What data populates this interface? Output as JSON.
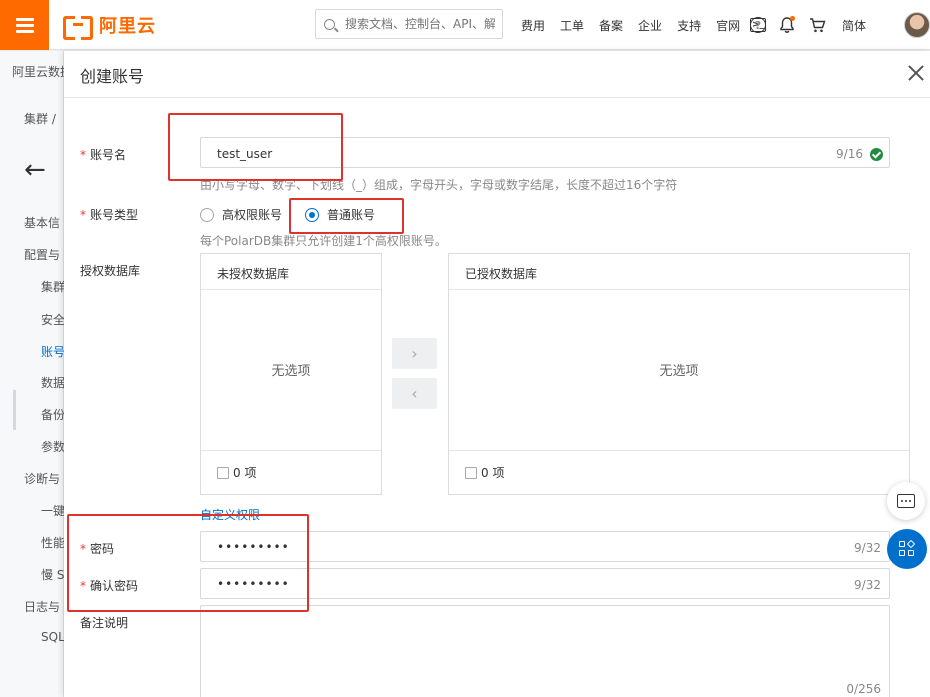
{
  "topbar": {
    "logo_text": "阿里云",
    "search_placeholder": "搜索文档、控制台、API、解",
    "links": [
      "费用",
      "工单",
      "备案",
      "企业",
      "支持",
      "官网"
    ],
    "terminal_icon_glyph": ">_",
    "help_icon_glyph": "?",
    "language": "简体",
    "accent": "#ff6a00"
  },
  "background_page": {
    "title": "阿里云数据",
    "breadcrumb": "集群",
    "breadcrumb_sep": "/",
    "items": [
      "基本信",
      "配置与",
      "集群",
      "安全",
      "账号",
      "数据",
      "备份",
      "参数",
      "诊断与",
      "一键",
      "性能",
      "慢 S",
      "日志与",
      "SQL"
    ]
  },
  "drawer": {
    "title": "创建账号",
    "account_name": {
      "label": "账号名",
      "value": "test_user",
      "counter": "9/16",
      "help": "由小写字母、数字、下划线（_）组成，字母开头，字母或数字结尾，长度不超过16个字符"
    },
    "account_type": {
      "label": "账号类型",
      "options": [
        "高权限账号",
        "普通账号"
      ],
      "selected": "普通账号",
      "help": "每个PolarDB集群只允许创建1个高权限账号。"
    },
    "authorized_db": {
      "label": "授权数据库",
      "left_title": "未授权数据库",
      "right_title": "已授权数据库",
      "empty_text": "无选项",
      "left_count": "0 项",
      "right_count": "0 项",
      "move_right_glyph": "›",
      "move_left_glyph": "‹"
    },
    "custom_permission_link": "自定义权限",
    "password": {
      "label": "密码",
      "value": "•••••••••",
      "counter": "9/32"
    },
    "confirm_password": {
      "label": "确认密码",
      "value": "•••••••••",
      "counter": "9/32"
    },
    "remark": {
      "label": "备注说明",
      "counter": "0/256"
    }
  },
  "colors": {
    "primary_blue": "#0070cc",
    "annotation_red": "#e0322c",
    "success_green": "#1e8e3e"
  }
}
